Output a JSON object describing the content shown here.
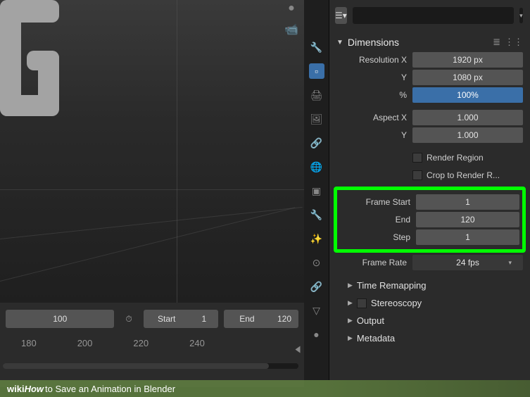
{
  "timeline": {
    "current_frame": "100",
    "start_label": "Start",
    "start_value": "1",
    "end_label": "End",
    "end_value": "120",
    "ruler": [
      "180",
      "200",
      "220",
      "240"
    ]
  },
  "panel": {
    "section_title": "Dimensions",
    "resolution_x_label": "Resolution X",
    "resolution_x": "1920 px",
    "resolution_y_label": "Y",
    "resolution_y": "1080 px",
    "percent_label": "%",
    "percent": "100%",
    "aspect_x_label": "Aspect X",
    "aspect_x": "1.000",
    "aspect_y_label": "Y",
    "aspect_y": "1.000",
    "render_region": "Render Region",
    "crop_to_render": "Crop to Render R...",
    "frame_start_label": "Frame Start",
    "frame_start": "1",
    "frame_end_label": "End",
    "frame_end": "120",
    "frame_step_label": "Step",
    "frame_step": "1",
    "frame_rate_label": "Frame Rate",
    "frame_rate": "24 fps",
    "time_remapping": "Time Remapping",
    "stereoscopy": "Stereoscopy",
    "output": "Output",
    "metadata": "Metadata"
  },
  "caption": {
    "logo": "wiki",
    "logo2": "How",
    "text": " to Save an Animation in Blender"
  }
}
